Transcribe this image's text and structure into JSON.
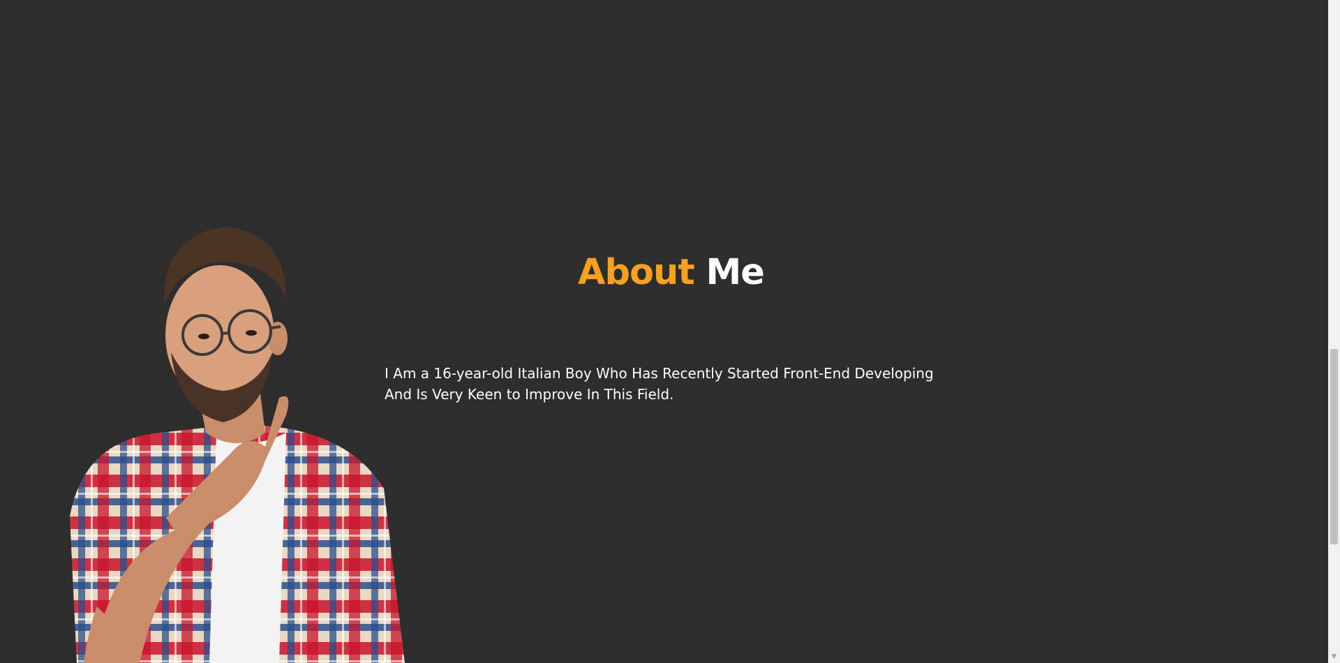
{
  "about": {
    "title_accent": "About",
    "title_rest": "Me",
    "description": "I Am a 16-year-old Italian Boy Who Has Recently Started Front-End Developing And Is Very Keen to Improve In This Field."
  },
  "portrait": {
    "icon": "thinking-man-photo"
  },
  "colors": {
    "background": "#2d2d2d",
    "accent": "#f7a11f",
    "text": "#ffffff"
  }
}
